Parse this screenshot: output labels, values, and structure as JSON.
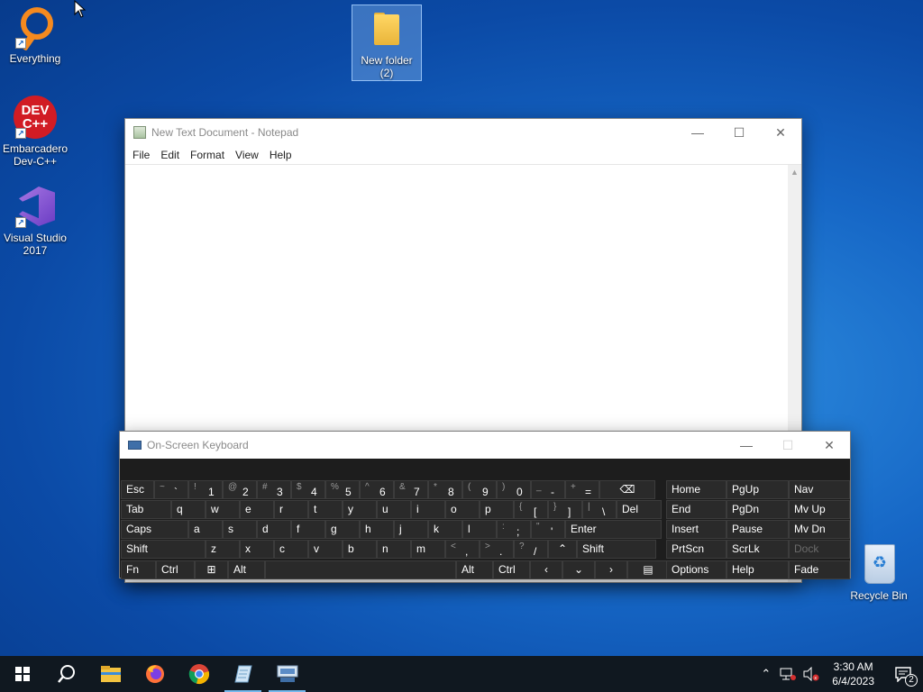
{
  "desktop": {
    "icons": [
      {
        "label_line1": "Everything",
        "label_line2": ""
      },
      {
        "label_line1": "Embarcadero",
        "label_line2": "Dev-C++"
      },
      {
        "label_line1": "Visual Studio",
        "label_line2": "2017"
      },
      {
        "label_line1": "New folder",
        "label_line2": "(2)"
      },
      {
        "label_line1": "Recycle Bin",
        "label_line2": ""
      }
    ],
    "devc_logo_line1": "DEV",
    "devc_logo_line2": "C++",
    "shortcut_arrow": "↗",
    "recycle_symbol": "♻"
  },
  "notepad": {
    "title": "New Text Document - Notepad",
    "menu": [
      "File",
      "Edit",
      "Format",
      "View",
      "Help"
    ],
    "minimize": "—",
    "maximize": "☐",
    "close": "✕",
    "scroll_up": "▲",
    "content": ""
  },
  "osk": {
    "title": "On-Screen Keyboard",
    "minimize": "—",
    "maximize": "☐",
    "close": "✕",
    "row1": [
      {
        "label": "Esc"
      },
      {
        "sub": "~",
        "main": "`"
      },
      {
        "sub": "!",
        "main": "1"
      },
      {
        "sub": "@",
        "main": "2"
      },
      {
        "sub": "#",
        "main": "3"
      },
      {
        "sub": "$",
        "main": "4"
      },
      {
        "sub": "%",
        "main": "5"
      },
      {
        "sub": "^",
        "main": "6"
      },
      {
        "sub": "&",
        "main": "7"
      },
      {
        "sub": "*",
        "main": "8"
      },
      {
        "sub": "(",
        "main": "9"
      },
      {
        "sub": ")",
        "main": "0"
      },
      {
        "sub": "_",
        "main": "-"
      },
      {
        "sub": "+",
        "main": "="
      },
      {
        "label": "⌫"
      }
    ],
    "row2": [
      "Tab",
      "q",
      "w",
      "e",
      "r",
      "t",
      "y",
      "u",
      "i",
      "o",
      "p",
      {
        "sub": "{",
        "main": "["
      },
      {
        "sub": "}",
        "main": "]"
      },
      {
        "sub": "|",
        "main": "\\"
      },
      "Del"
    ],
    "row3": [
      "Caps",
      "a",
      "s",
      "d",
      "f",
      "g",
      "h",
      "j",
      "k",
      "l",
      {
        "sub": ":",
        "main": ";"
      },
      {
        "sub": "\"",
        "main": "'"
      },
      "Enter"
    ],
    "row4": [
      "Shift",
      "z",
      "x",
      "c",
      "v",
      "b",
      "n",
      "m",
      {
        "sub": "<",
        "main": ","
      },
      {
        "sub": ">",
        "main": "."
      },
      {
        "sub": "?",
        "main": "/"
      },
      "⌃",
      "Shift"
    ],
    "row5": [
      "Fn",
      "Ctrl",
      "⊞",
      "Alt",
      "",
      "Alt",
      "Ctrl",
      "‹",
      "⌄",
      "›",
      "▤"
    ],
    "nav": [
      [
        "Home",
        "PgUp",
        "Nav"
      ],
      [
        "End",
        "PgDn",
        "Mv Up"
      ],
      [
        "Insert",
        "Pause",
        "Mv Dn"
      ],
      [
        "PrtScn",
        "ScrLk",
        "Dock"
      ],
      [
        "Options",
        "Help",
        "Fade"
      ]
    ]
  },
  "taskbar": {
    "search_icon": "⚲",
    "tray_chevron": "⌃",
    "notification_count": "2",
    "clock_time": "3:30 AM",
    "clock_date": "6/4/2023"
  }
}
